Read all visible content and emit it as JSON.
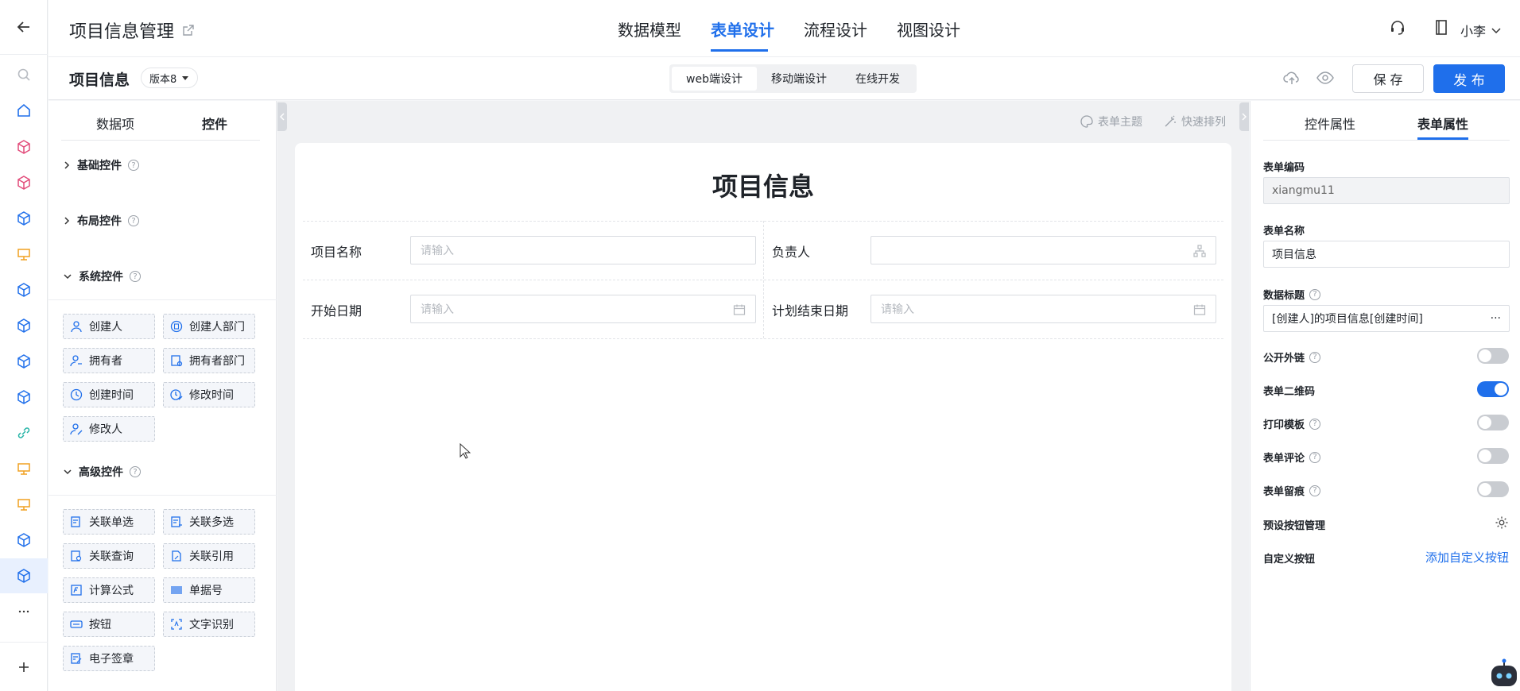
{
  "header": {
    "app_title": "项目信息管理",
    "nav": [
      "数据模型",
      "表单设计",
      "流程设计",
      "视图设计"
    ],
    "active_nav": "表单设计",
    "user": "小李"
  },
  "subheader": {
    "form_title": "项目信息",
    "version": "版本8",
    "modes": [
      "web端设计",
      "移动端设计",
      "在线开发"
    ],
    "active_mode": "web端设计",
    "save": "保 存",
    "publish": "发 布"
  },
  "left_panel": {
    "tabs": [
      "数据项",
      "控件"
    ],
    "active_tab": "控件",
    "sections": {
      "basic": "基础控件",
      "layout": "布局控件",
      "system": "系统控件",
      "advanced": "高级控件"
    },
    "system_controls": [
      "创建人",
      "创建人部门",
      "拥有者",
      "拥有者部门",
      "创建时间",
      "修改时间",
      "修改人"
    ],
    "advanced_controls": [
      "关联单选",
      "关联多选",
      "关联查询",
      "关联引用",
      "计算公式",
      "单据号",
      "按钮",
      "文字识别",
      "电子签章"
    ]
  },
  "canvas": {
    "tools": [
      "表单主题",
      "快速排列"
    ],
    "title": "项目信息",
    "fields": [
      {
        "label": "项目名称",
        "placeholder": "请输入"
      },
      {
        "label": "负责人",
        "placeholder": ""
      },
      {
        "label": "开始日期",
        "placeholder": "请输入"
      },
      {
        "label": "计划结束日期",
        "placeholder": "请输入"
      }
    ]
  },
  "right_panel": {
    "tabs": [
      "控件属性",
      "表单属性"
    ],
    "active_tab": "表单属性",
    "form_code_label": "表单编码",
    "form_code": "xiangmu11",
    "form_name_label": "表单名称",
    "form_name": "项目信息",
    "data_title_label": "数据标题",
    "data_title": "[创建人]的项目信息[创建时间]",
    "more": "···",
    "switches": [
      {
        "label": "公开外链",
        "on": false
      },
      {
        "label": "表单二维码",
        "on": true
      },
      {
        "label": "打印模板",
        "on": false
      },
      {
        "label": "表单评论",
        "on": false
      },
      {
        "label": "表单留痕",
        "on": false
      }
    ],
    "preset_buttons": "预设按钮管理",
    "custom_buttons": "自定义按钮",
    "add_custom_button": "添加自定义按钮"
  },
  "colors": {
    "accent": "#1f6feb",
    "rail_pink": "#e24b7a",
    "rail_orange": "#f0a020",
    "rail_teal": "#22b3a5"
  }
}
